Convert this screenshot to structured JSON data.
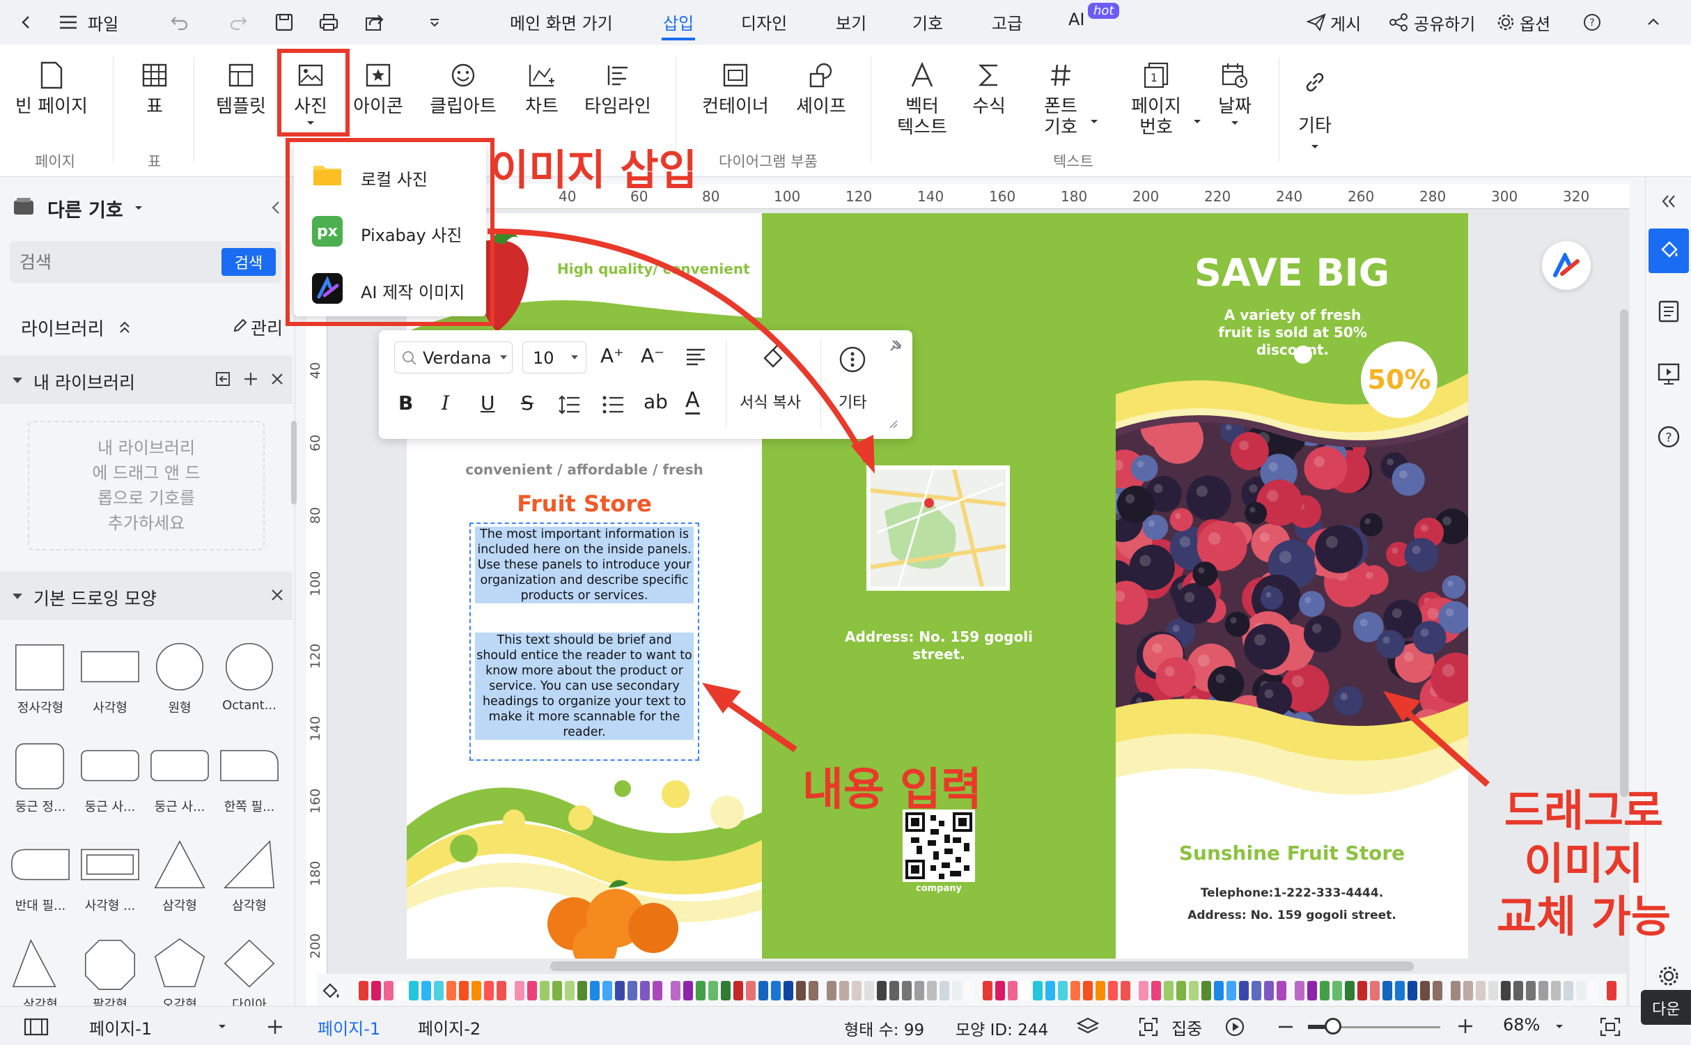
{
  "topbar": {
    "file": "파일",
    "menus": [
      "메인 화면 가기",
      "삽입",
      "디자인",
      "보기",
      "기호",
      "고급",
      "AI"
    ],
    "active_menu": "삽입",
    "ai_badge": "hot",
    "publish": "게시",
    "share": "공유하기",
    "options": "옵션"
  },
  "ribbon": {
    "buttons": [
      {
        "label": "빈 페이지",
        "icon": "blank-page-icon"
      },
      {
        "label": "표",
        "icon": "table-icon"
      },
      {
        "label": "템플릿",
        "icon": "template-icon"
      },
      {
        "label": "사진",
        "icon": "image-icon"
      },
      {
        "label": "아이콘",
        "icon": "star-icon"
      },
      {
        "label": "클립아트",
        "icon": "smiley-icon"
      },
      {
        "label": "차트",
        "icon": "chart-icon"
      },
      {
        "label": "타임라인",
        "icon": "timeline-icon"
      },
      {
        "label": "컨테이너",
        "icon": "container-icon"
      },
      {
        "label": "셰이프",
        "icon": "shapes-icon"
      },
      {
        "label": "벡터\n텍스트",
        "icon": "vector-text-icon"
      },
      {
        "label": "수식",
        "icon": "sigma-icon"
      },
      {
        "label": "폰트\n기호",
        "icon": "hash-icon"
      },
      {
        "label": "페이지\n번호",
        "icon": "page-number-icon"
      },
      {
        "label": "날짜",
        "icon": "calendar-icon"
      },
      {
        "label": "기타",
        "icon": "link-icon"
      }
    ],
    "groups": [
      "페이지",
      "표",
      "다이어그램 부품",
      "텍스트"
    ]
  },
  "photo_menu": {
    "items": [
      "로컬 사진",
      "Pixabay 사진",
      "AI 제작 이미지"
    ]
  },
  "sidebar": {
    "title": "다른 기호",
    "search_placeholder": "검색",
    "search_button": "검색",
    "library": "라이브러리",
    "manage": "관리",
    "my_library": "내 라이브러리",
    "drop_hint": "내 라이브러리\n에 드래그 앤 드\n롭으로 기호를\n추가하세요",
    "basic_shapes": "기본 드로잉 모양",
    "shapes": [
      "정사각형",
      "사각형",
      "원형",
      "Octant...",
      "둥근 정...",
      "둥근 사...",
      "둥근 사...",
      "한쪽 필...",
      "반대 필...",
      "사각형 ...",
      "삼각형",
      "삼각형",
      "삼각형",
      "팔각형",
      "오각형",
      "다이아"
    ]
  },
  "ruler": {
    "top": [
      "40",
      "60",
      "80",
      "100",
      "120",
      "140",
      "160",
      "180",
      "200",
      "220",
      "240",
      "260",
      "280",
      "300",
      "320"
    ],
    "left": [
      "40",
      "60",
      "80",
      "100",
      "120",
      "140",
      "160",
      "180",
      "200"
    ]
  },
  "text_toolbar": {
    "font": "Verdana",
    "size": "10",
    "format_copy": "서식 복사",
    "more": "기타"
  },
  "brochure": {
    "tagline": "High quality/ convenient",
    "subtitle": "convenient  / affordable / fresh",
    "store_title": "Fruit Store",
    "para1": "The most important information is included here on the inside panels. Use these panels to introduce your organization and describe specific products or services.",
    "para2": "This text should be brief and should entice the reader to want to know more about the product or service. You can use secondary headings to organize your text to make it more scannable for the reader.",
    "address_mid": "Address: No. 159 gogoli street.",
    "qr_label": "company",
    "save_big": "SAVE BIG",
    "save_sub": "A variety of fresh fruit is sold at 50% discount.",
    "discount": "50%",
    "store_name": "Sunshine Fruit Store",
    "telephone": "Telephone:1-222-333-4444.",
    "address_right": "Address: No. 159 gogoli street."
  },
  "annotations": {
    "insert_image": "이미지 삽입",
    "enter_content": "내용 입력",
    "drag_replace": "드래그로\n이미지\n교체 가능"
  },
  "bottombar": {
    "page_dropdown": "페이지-1",
    "tabs": [
      "페이지-1",
      "페이지-2"
    ],
    "shape_count": "형태 수: 99",
    "shape_id": "모양 ID: 244",
    "focus": "집중",
    "zoom": "68%",
    "download": "다운"
  },
  "colors": {
    "accent": "#1a6df2",
    "annotation": "#e8392a",
    "brochure_green": "#8bc23f",
    "title_orange": "#f05a28"
  }
}
